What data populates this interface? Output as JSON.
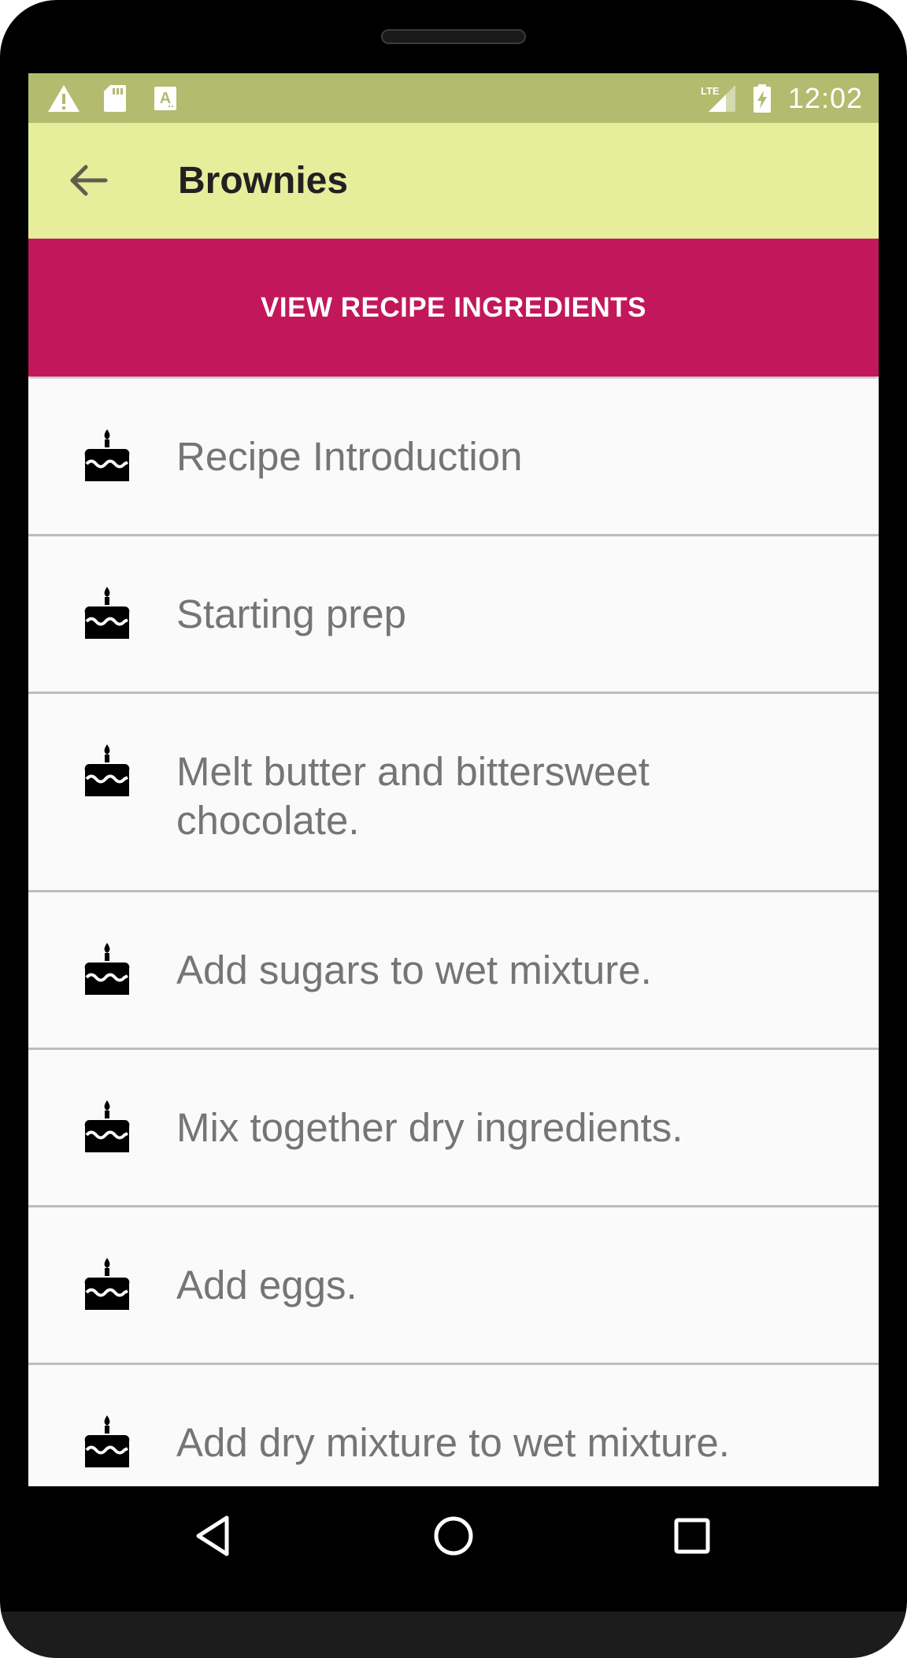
{
  "status_bar": {
    "time": "12:02",
    "left_icons": [
      "warning-icon",
      "sd-card-icon",
      "text-a-icon"
    ],
    "right_icons": [
      "lte-signal-icon",
      "battery-charging-icon"
    ],
    "network_label": "LTE"
  },
  "app_bar": {
    "title": "Brownies",
    "back_icon": "arrow-back-icon"
  },
  "ingredients_button": {
    "label": "VIEW RECIPE INGREDIENTS"
  },
  "steps": [
    {
      "label": "Recipe Introduction",
      "icon": "cake-icon"
    },
    {
      "label": "Starting prep",
      "icon": "cake-icon"
    },
    {
      "label": "Melt butter and bittersweet chocolate.",
      "icon": "cake-icon"
    },
    {
      "label": "Add sugars to wet mixture.",
      "icon": "cake-icon"
    },
    {
      "label": "Mix together dry ingredients.",
      "icon": "cake-icon"
    },
    {
      "label": "Add eggs.",
      "icon": "cake-icon"
    },
    {
      "label": "Add dry mixture to wet mixture.",
      "icon": "cake-icon"
    }
  ],
  "nav_bar": {
    "buttons": [
      "back-triangle-icon",
      "home-circle-icon",
      "recents-square-icon"
    ]
  },
  "colors": {
    "status_bar": "#b3bb6f",
    "app_bar": "#e6ee9c",
    "accent": "#c2185b",
    "list_background": "#fafafa",
    "divider": "#bdbdbd",
    "step_text": "#757575"
  }
}
